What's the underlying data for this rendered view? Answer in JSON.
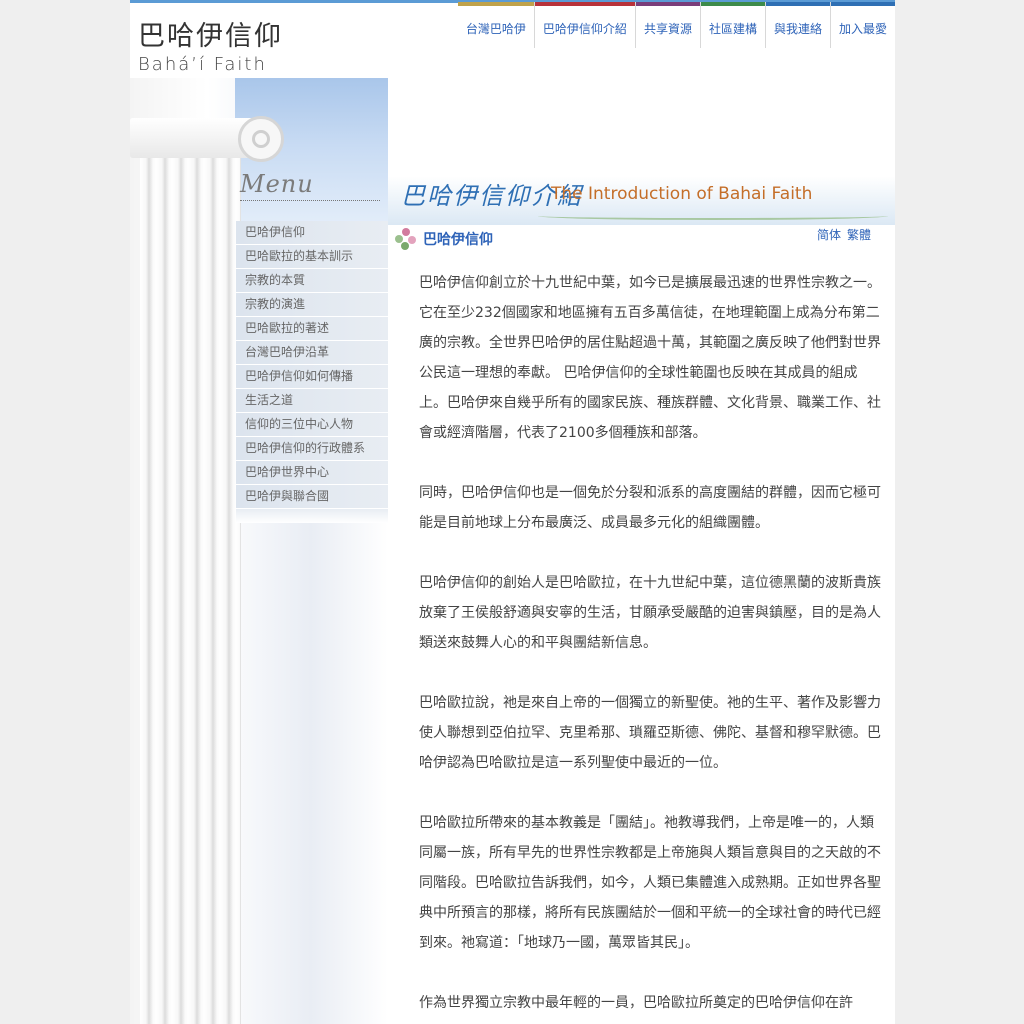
{
  "site": {
    "logo_cn": "巴哈伊信仰",
    "logo_en": "Bahá’í Faith"
  },
  "topnav": [
    {
      "label": "台灣巴哈伊",
      "color": "#c0a24a"
    },
    {
      "label": "巴哈伊信仰介紹",
      "color": "#b8323a"
    },
    {
      "label": "共享資源",
      "color": "#7a3d7a"
    },
    {
      "label": "社區建構",
      "color": "#3d8b4a"
    },
    {
      "label": "與我連絡",
      "color": "#2e6fb4"
    },
    {
      "label": "加入最愛",
      "color": "#2e6fb4"
    }
  ],
  "menu": {
    "heading": "Menu",
    "items": [
      "巴哈伊信仰",
      "巴哈歐拉的基本訓示",
      "宗教的本質",
      "宗教的演進",
      "巴哈歐拉的著述",
      "台灣巴哈伊沿革",
      "巴哈伊信仰如何傳播",
      "生活之道",
      "信仰的三位中心人物",
      "巴哈伊信仰的行政體系",
      "巴哈伊世界中心",
      "巴哈伊與聯合國"
    ]
  },
  "banner": {
    "title_cn": "巴哈伊信仰介紹",
    "title_en": "The Introduction of Bahai Faith"
  },
  "section": {
    "title": "巴哈伊信仰",
    "lang_simplified": "简体",
    "lang_traditional": "繁體"
  },
  "paragraphs": [
    "巴哈伊信仰創立於十九世紀中葉，如今已是擴展最迅速的世界性宗教之一。它在至少232個國家和地區擁有五百多萬信徒，在地理範圍上成為分布第二廣的宗教。全世界巴哈伊的居住點超過十萬，其範圍之廣反映了他們對世界公民這一理想的奉獻。 巴哈伊信仰的全球性範圍也反映在其成員的組成上。巴哈伊來自幾乎所有的國家民族、種族群體、文化背景、職業工作、社會或經濟階層，代表了2100多個種族和部落。",
    "同時，巴哈伊信仰也是一個免於分裂和派系的高度團結的群體，因而它極可能是目前地球上分布最廣泛、成員最多元化的組織團體。",
    "巴哈伊信仰的創始人是巴哈歐拉，在十九世紀中葉，這位德黑蘭的波斯貴族放棄了王侯般舒適與安寧的生活，甘願承受嚴酷的迫害與鎮壓，目的是為人類送來鼓舞人心的和平與團結新信息。",
    "巴哈歐拉說，祂是來自上帝的一個獨立的新聖使。祂的生平、著作及影響力使人聯想到亞伯拉罕、克里希那、瑣羅亞斯德、佛陀、基督和穆罕默德。巴哈伊認為巴哈歐拉是這一系列聖使中最近的一位。",
    "巴哈歐拉所帶來的基本教義是「團結」。祂教導我們，上帝是唯一的，人類同屬一族，所有早先的世界性宗教都是上帝施與人類旨意與目的之天啟的不同階段。巴哈歐拉告訴我們，如今，人類已集體進入成熟期。正如世界各聖典中所預言的那樣，將所有民族團結於一個和平統一的全球社會的時代已經到來。祂寫道：「地球乃一國，萬眾皆其民」。",
    "作為世界獨立宗教中最年輕的一員，巴哈歐拉所奠定的巴哈伊信仰在許"
  ]
}
